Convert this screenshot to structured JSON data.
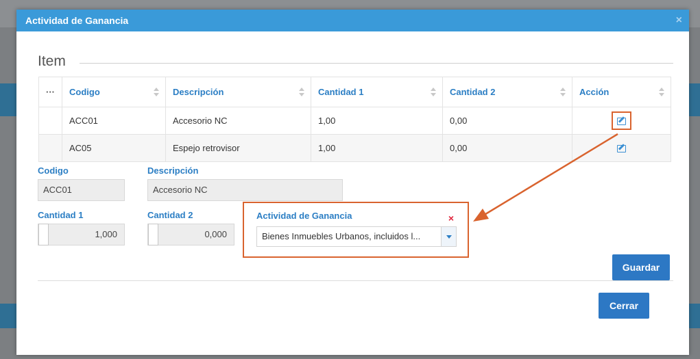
{
  "modal": {
    "title": "Actividad de Ganancia",
    "close_symbol": "×"
  },
  "section": {
    "legend": "Item"
  },
  "table": {
    "headers": {
      "menu": "···",
      "codigo": "Codigo",
      "descripcion": "Descripción",
      "cantidad1": "Cantidad 1",
      "cantidad2": "Cantidad 2",
      "accion": "Acción"
    },
    "rows": [
      {
        "codigo": "ACC01",
        "descripcion": "Accesorio NC",
        "cantidad1": "1,00",
        "cantidad2": "0,00",
        "accion_icon": "edit-icon"
      },
      {
        "codigo": "AC05",
        "descripcion": "Espejo retrovisor",
        "cantidad1": "1,00",
        "cantidad2": "0,00",
        "accion_icon": "edit-icon"
      }
    ]
  },
  "form": {
    "codigo_label": "Codigo",
    "codigo_value": "ACC01",
    "descripcion_label": "Descripción",
    "descripcion_value": "Accesorio NC",
    "cantidad1_label": "Cantidad 1",
    "cantidad1_value": "1,000",
    "cantidad2_label": "Cantidad 2",
    "cantidad2_value": "0,000",
    "actividad_label": "Actividad de Ganancia",
    "actividad_clear": "×",
    "actividad_value": "Bienes Inmuebles Urbanos, incluidos l..."
  },
  "buttons": {
    "guardar": "Guardar",
    "cerrar": "Cerrar"
  },
  "colors": {
    "header": "#3a9ad9",
    "accent": "#2b7ec4",
    "highlight": "#d9632e",
    "button": "#2d78c4"
  }
}
